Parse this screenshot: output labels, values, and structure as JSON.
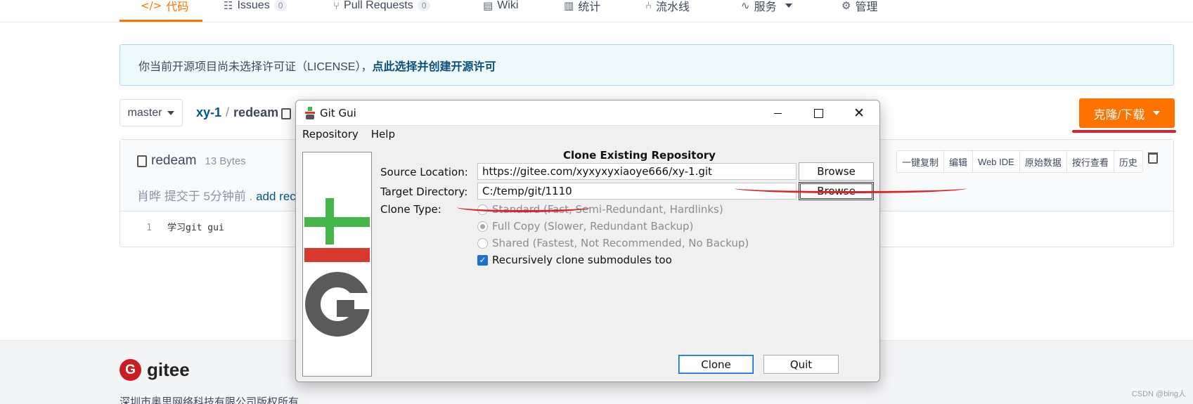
{
  "nav": {
    "tabs": [
      {
        "icon": "</>",
        "label": "代码"
      },
      {
        "icon": "☷",
        "label": "Issues",
        "count": "0"
      },
      {
        "icon": "⑂",
        "label": "Pull Requests",
        "count": "0"
      },
      {
        "icon": "▤",
        "label": "Wiki"
      },
      {
        "icon": "▥",
        "label": "统计"
      },
      {
        "icon": "⑃",
        "label": "流水线"
      },
      {
        "icon": "∿",
        "label": "服务"
      },
      {
        "icon": "⚙",
        "label": "管理"
      }
    ]
  },
  "license_banner": {
    "text": "你当前开源项目尚未选择许可证（LICENSE），",
    "link": "点此选择并创建开源许可"
  },
  "repo": {
    "branch": "master",
    "owner": "xy-1",
    "separator": "/",
    "file": "redeam",
    "clone_button": "克隆/下载"
  },
  "file_view": {
    "name": "redeam",
    "size": "13 Bytes",
    "commit_author_time": "肖晔 提交于 5分钟前 .",
    "commit_message": "add rec",
    "toolbar": [
      "一键复制",
      "编辑",
      "Web IDE",
      "原始数据",
      "按行查看",
      "历史"
    ],
    "lines": [
      {
        "num": "1",
        "code": "学习git gui"
      }
    ]
  },
  "footer": {
    "logo": "G",
    "brand": "gitee",
    "copyright": "深圳市奥思网络科技有限公司版权所有",
    "watermark": "CSDN @bing人"
  },
  "dialog": {
    "title": "Git Gui",
    "menu": [
      "Repository",
      "Help"
    ],
    "heading": "Clone Existing Repository",
    "source_label": "Source Location:",
    "source_value": "https://gitee.com/xyxyxyxiaoye666/xy-1.git",
    "target_label": "Target Directory:",
    "target_value": "C:/temp/git/1110",
    "browse": "Browse",
    "clone_type_label": "Clone Type:",
    "clone_types": [
      {
        "label": "Standard (Fast, Semi-Redundant, Hardlinks)",
        "selected": false
      },
      {
        "label": "Full Copy (Slower, Redundant Backup)",
        "selected": true
      },
      {
        "label": "Shared (Fastest, Not Recommended, No Backup)",
        "selected": false
      }
    ],
    "submodules": {
      "label": "Recursively clone submodules too",
      "checked": true
    },
    "clone_button": "Clone",
    "quit_button": "Quit"
  },
  "colors": {
    "accent": "#fe7300",
    "link": "#005980",
    "annotation_red": "#d9232d"
  }
}
